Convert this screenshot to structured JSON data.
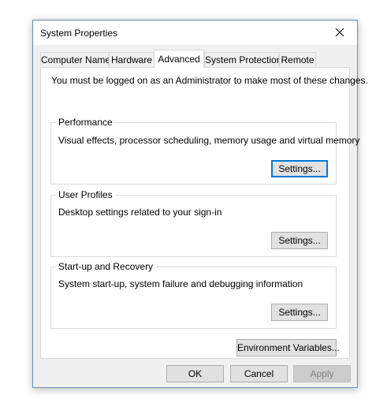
{
  "window": {
    "title": "System Properties"
  },
  "tabs": [
    {
      "label": "Computer Name",
      "active": false
    },
    {
      "label": "Hardware",
      "active": false
    },
    {
      "label": "Advanced",
      "active": true
    },
    {
      "label": "System Protection",
      "active": false
    },
    {
      "label": "Remote",
      "active": false
    }
  ],
  "advanced": {
    "admin_note": "You must be logged on as an Administrator to make most of these changes.",
    "performance": {
      "legend": "Performance",
      "description": "Visual effects, processor scheduling, memory usage and virtual memory",
      "button": "Settings..."
    },
    "user_profiles": {
      "legend": "User Profiles",
      "description": "Desktop settings related to your sign-in",
      "button": "Settings..."
    },
    "startup_recovery": {
      "legend": "Start-up and Recovery",
      "description": "System start-up, system failure and debugging information",
      "button": "Settings..."
    },
    "env_vars_button": "Environment Variables..."
  },
  "footer": {
    "ok": "OK",
    "cancel": "Cancel",
    "apply": "Apply"
  },
  "colors": {
    "accent": "#0078d7",
    "window_bg": "#f0f0f0",
    "panel_bg": "#ffffff",
    "disabled_text": "#838383"
  },
  "icons": {
    "close": "close-icon"
  }
}
